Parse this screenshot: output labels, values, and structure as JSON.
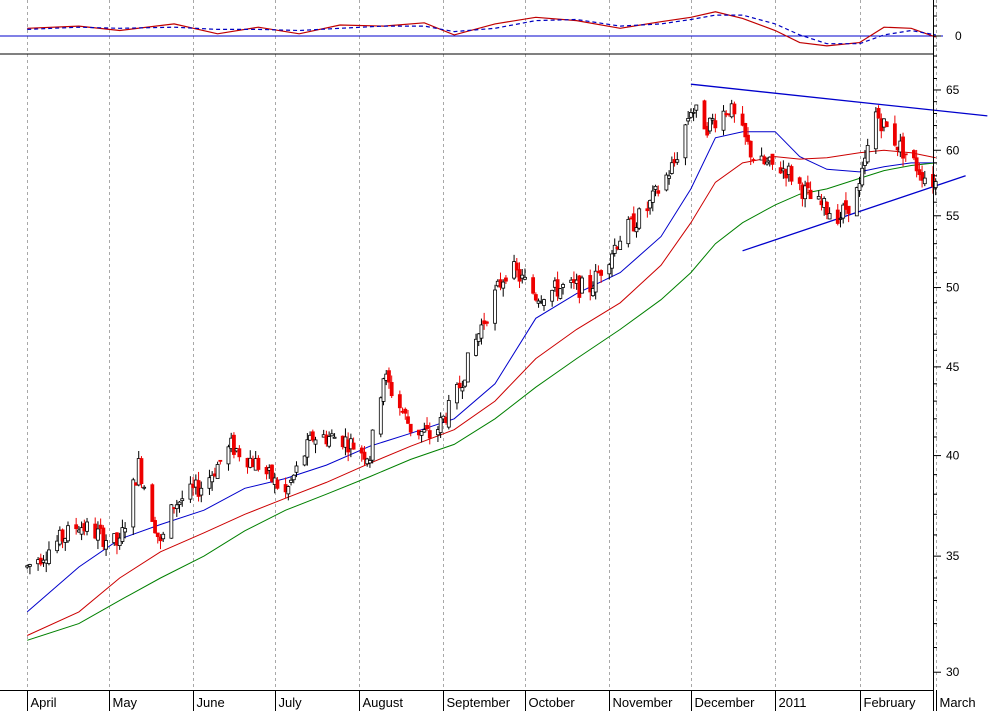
{
  "chart_data": [
    {
      "type": "line",
      "panel": "oscillator",
      "y_ticks": [
        0
      ],
      "series": [
        {
          "style": "solid",
          "color": "#c00000",
          "x": [
            "2010-04-01",
            "2010-04-20",
            "2010-05-05",
            "2010-05-25",
            "2010-06-10",
            "2010-06-25",
            "2010-07-10",
            "2010-07-25",
            "2010-08-10",
            "2010-08-25",
            "2010-09-05",
            "2010-09-20",
            "2010-10-05",
            "2010-10-20",
            "2010-11-05",
            "2010-11-20",
            "2010-12-01",
            "2010-12-10",
            "2010-12-20",
            "2011-01-01",
            "2011-01-10",
            "2011-01-20",
            "2011-02-01",
            "2011-02-10",
            "2011-02-20",
            "2011-03-01"
          ],
          "values": [
            0.35,
            0.45,
            0.25,
            0.55,
            0.1,
            0.4,
            0.1,
            0.5,
            0.45,
            0.6,
            0.05,
            0.55,
            0.85,
            0.7,
            0.35,
            0.65,
            0.85,
            1.1,
            0.8,
            0.25,
            -0.3,
            -0.45,
            -0.3,
            0.4,
            0.35,
            -0.05
          ]
        },
        {
          "style": "dashed",
          "color": "#0000c0",
          "x": [
            "2010-04-01",
            "2010-04-20",
            "2010-05-05",
            "2010-05-25",
            "2010-06-10",
            "2010-06-25",
            "2010-07-10",
            "2010-07-25",
            "2010-08-10",
            "2010-08-25",
            "2010-09-05",
            "2010-09-20",
            "2010-10-05",
            "2010-10-20",
            "2010-11-05",
            "2010-11-20",
            "2010-12-01",
            "2010-12-10",
            "2010-12-20",
            "2011-01-01",
            "2011-01-10",
            "2011-01-20",
            "2011-02-01",
            "2011-02-10",
            "2011-02-20",
            "2011-03-01"
          ],
          "values": [
            0.3,
            0.4,
            0.35,
            0.4,
            0.3,
            0.3,
            0.25,
            0.35,
            0.45,
            0.45,
            0.2,
            0.35,
            0.7,
            0.75,
            0.45,
            0.55,
            0.75,
            0.95,
            0.95,
            0.55,
            0.05,
            -0.35,
            -0.35,
            0.05,
            0.25,
            0.05
          ]
        }
      ]
    },
    {
      "type": "line",
      "panel": "price",
      "scale": "log",
      "ylim": [
        29.3,
        68
      ],
      "y_ticks": [
        30,
        35,
        40,
        45,
        50,
        55,
        60,
        65
      ],
      "x_ticks": [
        {
          "label": "April",
          "date": "2010-04-01"
        },
        {
          "label": "May",
          "date": "2010-05-01"
        },
        {
          "label": "June",
          "date": "2010-06-01"
        },
        {
          "label": "July",
          "date": "2010-07-01"
        },
        {
          "label": "August",
          "date": "2010-08-01"
        },
        {
          "label": "September",
          "date": "2010-09-01"
        },
        {
          "label": "October",
          "date": "2010-10-01"
        },
        {
          "label": "November",
          "date": "2010-11-01"
        },
        {
          "label": "December",
          "date": "2010-12-01"
        },
        {
          "label": "2011",
          "date": "2011-01-01"
        },
        {
          "label": "February",
          "date": "2011-02-01"
        },
        {
          "label": "March",
          "date": "2011-03-01"
        }
      ],
      "series": [
        {
          "kind": "price",
          "color": "#000000",
          "x": [
            "2010-04-01",
            "2010-04-20",
            "2010-05-05",
            "2010-05-12",
            "2010-05-20",
            "2010-05-25",
            "2010-06-05",
            "2010-06-15",
            "2010-06-25",
            "2010-07-05",
            "2010-07-15",
            "2010-07-25",
            "2010-08-05",
            "2010-08-10",
            "2010-08-20",
            "2010-08-28",
            "2010-09-05",
            "2010-09-15",
            "2010-09-25",
            "2010-10-05",
            "2010-10-15",
            "2010-10-25",
            "2010-11-05",
            "2010-11-15",
            "2010-11-25",
            "2010-12-01",
            "2010-12-07",
            "2010-12-15",
            "2010-12-25",
            "2011-01-05",
            "2011-01-15",
            "2011-01-25",
            "2011-02-01",
            "2011-02-07",
            "2011-02-15",
            "2011-02-25",
            "2011-03-01"
          ],
          "values": [
            34.5,
            36.5,
            35.5,
            39.5,
            35.5,
            37.5,
            38.5,
            40.5,
            39.5,
            38.0,
            41.0,
            41.0,
            40.0,
            44.5,
            41.5,
            41.0,
            43.0,
            47.5,
            51.5,
            49.5,
            50.0,
            50.0,
            53.5,
            55.5,
            59.0,
            63.5,
            62.0,
            63.5,
            59.0,
            58.5,
            56.0,
            55.0,
            57.0,
            63.0,
            60.5,
            58.0,
            57.5
          ]
        },
        {
          "kind": "moving-average",
          "color": "#0000cc",
          "x": [
            "2010-04-01",
            "2010-04-20",
            "2010-05-05",
            "2010-05-20",
            "2010-06-05",
            "2010-06-20",
            "2010-07-05",
            "2010-07-20",
            "2010-08-05",
            "2010-08-20",
            "2010-09-05",
            "2010-09-20",
            "2010-10-05",
            "2010-10-20",
            "2010-11-05",
            "2010-11-20",
            "2010-12-01",
            "2010-12-10",
            "2010-12-20",
            "2011-01-01",
            "2011-01-10",
            "2011-01-20",
            "2011-02-01",
            "2011-02-10",
            "2011-02-20",
            "2011-03-01"
          ],
          "values": [
            32.5,
            34.5,
            35.8,
            36.5,
            37.2,
            38.3,
            38.8,
            39.5,
            40.5,
            41.2,
            42.0,
            44.0,
            48.0,
            49.6,
            51.0,
            53.5,
            57.0,
            61.0,
            61.5,
            61.5,
            59.5,
            58.5,
            58.3,
            58.7,
            59.0,
            59.0
          ]
        },
        {
          "kind": "moving-average",
          "color": "#cc0000",
          "x": [
            "2010-04-01",
            "2010-04-20",
            "2010-05-05",
            "2010-05-20",
            "2010-06-05",
            "2010-06-20",
            "2010-07-05",
            "2010-07-20",
            "2010-08-05",
            "2010-08-20",
            "2010-09-05",
            "2010-09-20",
            "2010-10-05",
            "2010-10-20",
            "2010-11-05",
            "2010-11-20",
            "2010-12-01",
            "2010-12-10",
            "2010-12-20",
            "2011-01-01",
            "2011-01-10",
            "2011-01-20",
            "2011-02-01",
            "2011-02-10",
            "2011-02-20",
            "2011-03-01"
          ],
          "values": [
            31.5,
            32.5,
            34.0,
            35.2,
            36.1,
            37.0,
            37.8,
            38.6,
            39.6,
            40.5,
            41.4,
            43.0,
            45.5,
            47.3,
            49.0,
            51.5,
            54.5,
            57.5,
            59.0,
            59.5,
            59.3,
            59.4,
            59.8,
            60.0,
            59.8,
            59.4
          ]
        },
        {
          "kind": "moving-average",
          "color": "#008000",
          "x": [
            "2010-04-01",
            "2010-04-20",
            "2010-05-05",
            "2010-05-20",
            "2010-06-05",
            "2010-06-20",
            "2010-07-05",
            "2010-07-20",
            "2010-08-05",
            "2010-08-20",
            "2010-09-05",
            "2010-09-20",
            "2010-10-05",
            "2010-10-20",
            "2010-11-05",
            "2010-11-20",
            "2010-12-01",
            "2010-12-10",
            "2010-12-20",
            "2011-01-01",
            "2011-01-10",
            "2011-01-20",
            "2011-02-01",
            "2011-02-10",
            "2011-02-20",
            "2011-03-01"
          ],
          "values": [
            31.3,
            32.0,
            33.0,
            34.0,
            35.0,
            36.2,
            37.2,
            38.0,
            38.9,
            39.8,
            40.6,
            42.0,
            43.8,
            45.5,
            47.3,
            49.2,
            51.0,
            53.0,
            54.5,
            55.8,
            56.6,
            57.0,
            57.8,
            58.4,
            58.8,
            59.0
          ]
        }
      ],
      "annotations": [
        {
          "type": "trendline",
          "color": "#0000cc",
          "x": [
            "2010-12-01",
            "2011-03-20"
          ],
          "values": [
            65.5,
            62.8
          ]
        },
        {
          "type": "trendline",
          "color": "#0000cc",
          "x": [
            "2010-12-20",
            "2011-03-12"
          ],
          "values": [
            52.5,
            58.0
          ]
        }
      ]
    }
  ]
}
